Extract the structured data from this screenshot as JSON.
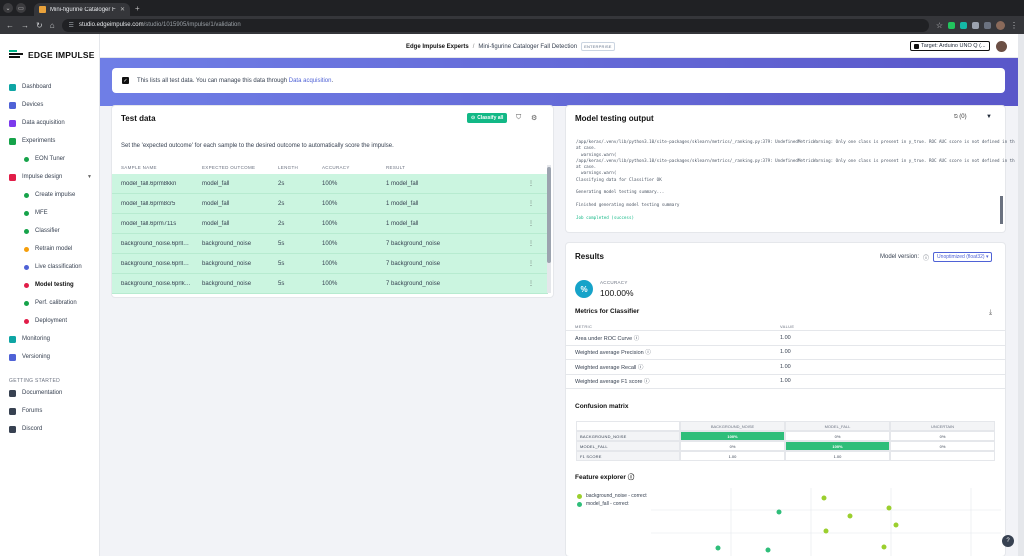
{
  "browser": {
    "tab_title": "Mini-figurine Cataloger Fall De",
    "url_domain": "studio.edgeimpulse.com",
    "url_path": "/studio/1015905/impulse/1/validation"
  },
  "sidebar": {
    "brand": "EDGE IMPULSE",
    "items": [
      {
        "label": "Dashboard",
        "color": "#0ea5a4"
      },
      {
        "label": "Devices",
        "color": "#4f62d6"
      },
      {
        "label": "Data acquisition",
        "color": "#7c3aed"
      },
      {
        "label": "Experiments",
        "color": "#16a34a"
      },
      {
        "label": "EON Tuner",
        "color": "#16a34a"
      },
      {
        "label": "Impulse design",
        "color": "#e11d48"
      },
      {
        "label": "Create impulse",
        "color": "#16a34a"
      },
      {
        "label": "MFE",
        "color": "#16a34a"
      },
      {
        "label": "Classifier",
        "color": "#16a34a"
      },
      {
        "label": "Retrain model",
        "color": "#f59e0b"
      },
      {
        "label": "Live classification",
        "color": "#4f62d6"
      },
      {
        "label": "Model testing",
        "color": "#e11d48"
      },
      {
        "label": "Perf. calibration",
        "color": "#16a34a"
      },
      {
        "label": "Deployment",
        "color": "#e11d48"
      },
      {
        "label": "Monitoring",
        "color": "#0ea5a4"
      },
      {
        "label": "Versioning",
        "color": "#4f62d6"
      }
    ],
    "getting_started": "GETTING STARTED",
    "gs_items": [
      "Documentation",
      "Forums",
      "Discord"
    ]
  },
  "topbar": {
    "org": "Edge Impulse Experts",
    "project": "Mini-figurine Cataloger Fall Detection",
    "badge": "ENTERPRISE",
    "target": "Target: Arduino UNO Q (..."
  },
  "banner": {
    "text": "This lists all test data. You can manage this data through ",
    "link": "Data acquisition",
    "tail": "."
  },
  "test_data": {
    "title": "Test data",
    "classify_all": "Classify all",
    "description": "Set the 'expected outcome' for each sample to the desired outcome to automatically score the impulse.",
    "columns": [
      "SAMPLE NAME",
      "EXPECTED OUTCOME",
      "LENGTH",
      "ACCURACY",
      "RESULT"
    ],
    "rows": [
      {
        "name": "model_fall.6prm8kkn",
        "expected": "model_fall",
        "length": "2s",
        "accuracy": "100%",
        "result": "1 model_fall"
      },
      {
        "name": "model_fall.6prm8cr5",
        "expected": "model_fall",
        "length": "2s",
        "accuracy": "100%",
        "result": "1 model_fall"
      },
      {
        "name": "model_fall.6prm711s",
        "expected": "model_fall",
        "length": "2s",
        "accuracy": "100%",
        "result": "1 model_fall"
      },
      {
        "name": "background_noise.6prlln24",
        "expected": "background_noise",
        "length": "5s",
        "accuracy": "100%",
        "result": "7 background_noise"
      },
      {
        "name": "background_noise.6prll426",
        "expected": "background_noise",
        "length": "5s",
        "accuracy": "100%",
        "result": "7 background_noise"
      },
      {
        "name": "background_noise.6prlkm...",
        "expected": "background_noise",
        "length": "5s",
        "accuracy": "100%",
        "result": "7 background_noise"
      }
    ]
  },
  "output": {
    "title": "Model testing output",
    "filter": "(0)",
    "log": [
      "/app/keras/.venv/lib/python3.10/site-packages/sklearn/metrics/_ranking.py:379: UndefinedMetricWarning: Only one class is present in y_true. ROC AUC score is not defined in th",
      "at case.",
      "  warnings.warn(",
      "/app/keras/.venv/lib/python3.10/site-packages/sklearn/metrics/_ranking.py:379: UndefinedMetricWarning: Only one class is present in y_true. ROC AUC score is not defined in th",
      "at case.",
      "  warnings.warn(",
      "Classifying data for Classifier OK",
      "",
      "Generating model testing summary...",
      "",
      "Finished generating model testing summary",
      ""
    ],
    "log_ok": "Job completed (success)"
  },
  "results": {
    "title": "Results",
    "model_version_label": "Model version:",
    "model_version": "Unoptimized (float32)",
    "accuracy_label": "ACCURACY",
    "accuracy": "100.00%",
    "metrics_title": "Metrics for Classifier",
    "metric_head": "METRIC",
    "value_head": "VALUE",
    "metrics": [
      {
        "name": "Area under ROC Curve",
        "value": "1.00"
      },
      {
        "name": "Weighted average Precision",
        "value": "1.00"
      },
      {
        "name": "Weighted average Recall",
        "value": "1.00"
      },
      {
        "name": "Weighted average F1 score",
        "value": "1.00"
      }
    ],
    "confusion_title": "Confusion matrix",
    "cm_cols": [
      "BACKGROUND_NOISE",
      "MODEL_FALL",
      "UNCERTAIN"
    ],
    "cm_rows": [
      {
        "label": "BACKGROUND_NOISE",
        "cells": [
          "100%",
          "0%",
          "0%"
        ]
      },
      {
        "label": "MODEL_FALL",
        "cells": [
          "0%",
          "100%",
          "0%"
        ]
      },
      {
        "label": "F1 SCORE",
        "cells": [
          "1.00",
          "1.00",
          ""
        ]
      }
    ],
    "feature_title": "Feature explorer",
    "legend": [
      {
        "label": "background_noise - correct",
        "color": "#9bcf2e"
      },
      {
        "label": "model_fall - correct",
        "color": "#2fbe7a"
      }
    ]
  }
}
